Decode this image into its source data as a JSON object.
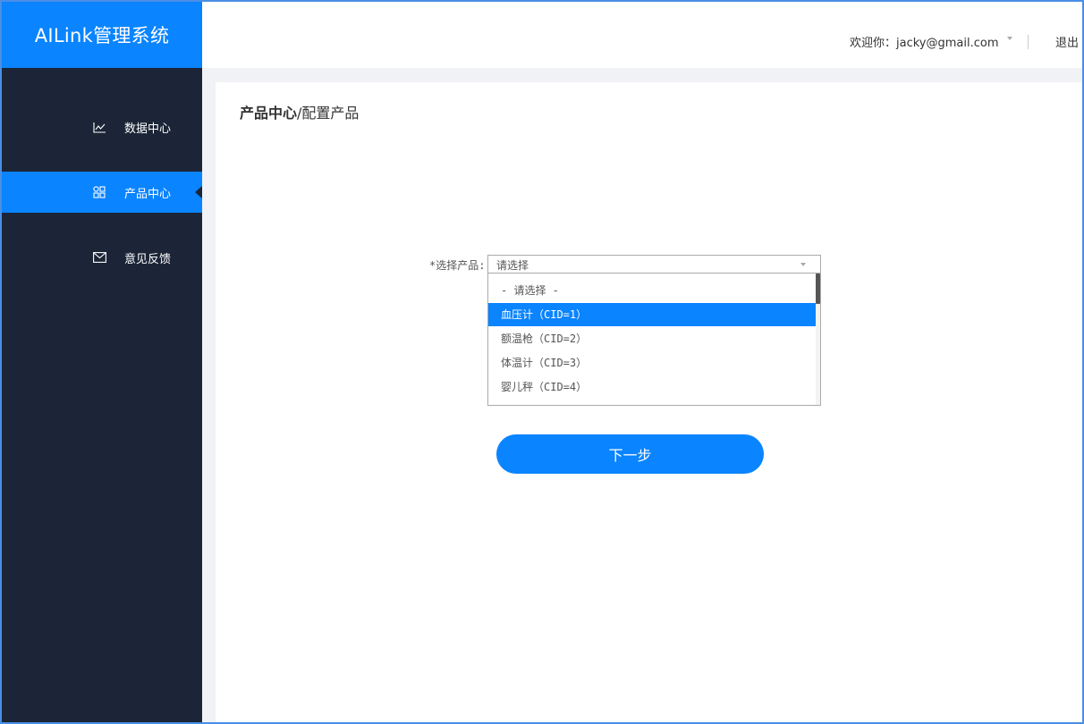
{
  "app": {
    "title": "AILink管理系统"
  },
  "header": {
    "welcome": "欢迎你：jacky@gmail.com",
    "logout": "退出"
  },
  "sidebar": {
    "items": [
      {
        "label": "数据中心",
        "icon": "line-chart-icon",
        "active": false
      },
      {
        "label": "产品中心",
        "icon": "grid-icon",
        "active": true
      },
      {
        "label": "意见反馈",
        "icon": "mail-icon",
        "active": false
      }
    ]
  },
  "breadcrumb": {
    "parent": "产品中心",
    "separator": "/",
    "current": "配置产品"
  },
  "form": {
    "label": "*选择产品:",
    "select": {
      "value": "请选择",
      "options": [
        {
          "label": "- 请选择 -",
          "selected": false
        },
        {
          "label": "血压计（CID=1）",
          "selected": true
        },
        {
          "label": "额温枪（CID=2）",
          "selected": false
        },
        {
          "label": "体温计（CID=3）",
          "selected": false
        },
        {
          "label": "婴儿秤（CID=4）",
          "selected": false
        }
      ]
    },
    "next_button": "下一步"
  },
  "colors": {
    "accent": "#0a84ff",
    "sidebar_bg": "#1b2537"
  }
}
